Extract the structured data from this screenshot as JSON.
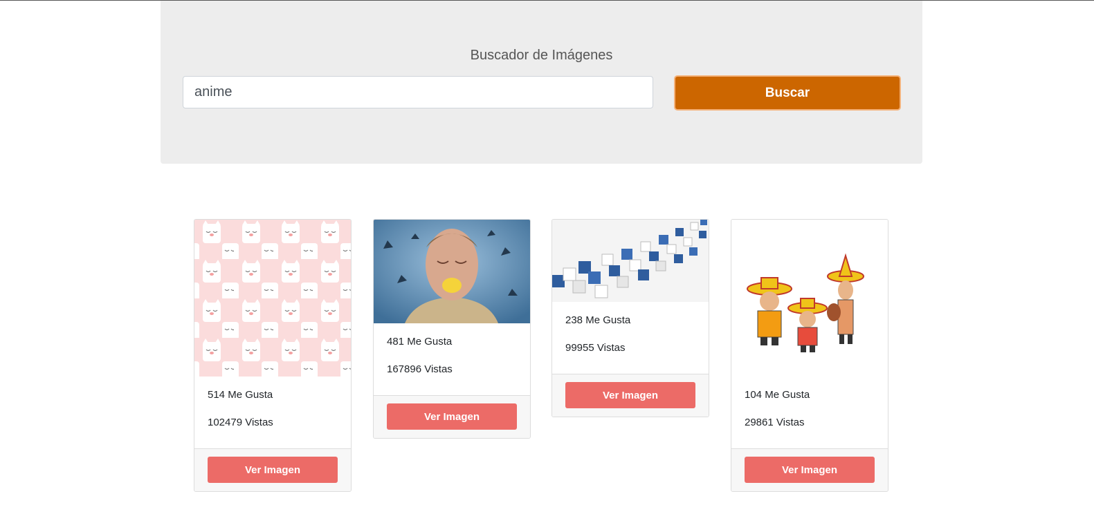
{
  "header": {
    "title": "Buscador de Imágenes",
    "search_value": "anime",
    "search_button": "Buscar"
  },
  "cards": [
    {
      "image": "pink-cat-pattern-image",
      "likes": "514 Me Gusta",
      "views": "102479 Vistas",
      "button": "Ver Imagen"
    },
    {
      "image": "man-eating-lemon-image",
      "likes": "481 Me Gusta",
      "views": "167896 Vistas",
      "button": "Ver Imagen"
    },
    {
      "image": "blue-white-cubes-image",
      "likes": "238 Me Gusta",
      "views": "99955 Vistas",
      "button": "Ver Imagen"
    },
    {
      "image": "mariachi-cartoon-image",
      "likes": "104 Me Gusta",
      "views": "29861 Vistas",
      "button": "Ver Imagen"
    }
  ],
  "colors": {
    "jumbotron_bg": "#ededed",
    "search_button": "#cc6600",
    "card_button": "#ec6b67"
  }
}
